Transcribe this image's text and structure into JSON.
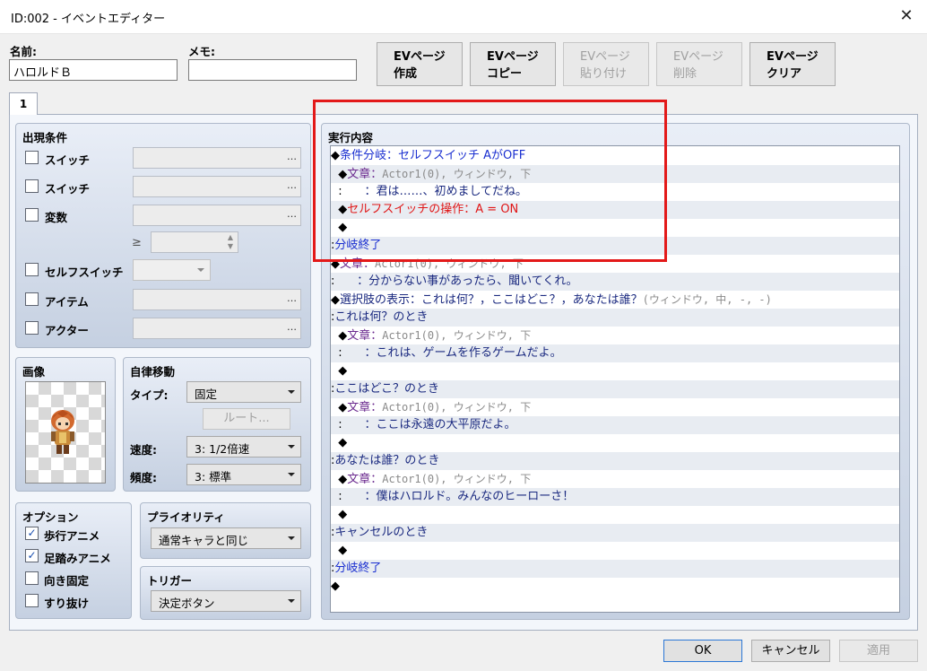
{
  "window": {
    "title": "ID:002 - イベントエディター",
    "close_label": "✕"
  },
  "fields": {
    "name_label": "名前:",
    "name_value": "ハロルドＢ",
    "memo_label": "メモ:",
    "memo_value": ""
  },
  "page_buttons": [
    {
      "line1": "EVページ",
      "line2": "作成",
      "enabled": true
    },
    {
      "line1": "EVページ",
      "line2": "コピー",
      "enabled": true
    },
    {
      "line1": "EVページ",
      "line2": "貼り付け",
      "enabled": false
    },
    {
      "line1": "EVページ",
      "line2": "削除",
      "enabled": false
    },
    {
      "line1": "EVページ",
      "line2": "クリア",
      "enabled": true
    }
  ],
  "tab": {
    "label": "1"
  },
  "conditions": {
    "title": "出現条件",
    "switch1": "スイッチ",
    "switch2": "スイッチ",
    "variable": "変数",
    "ge": "≥",
    "selfswitch": "セルフスイッチ",
    "item": "アイテム",
    "actor": "アクター",
    "dots": "…"
  },
  "image": {
    "title": "画像"
  },
  "autonomous": {
    "title": "自律移動",
    "type_label": "タイプ:",
    "type_value": "固定",
    "route_label": "ルート...",
    "speed_label": "速度:",
    "speed_value": "3: 1/2倍速",
    "freq_label": "頻度:",
    "freq_value": "3: 標準"
  },
  "options": {
    "title": "オプション",
    "walk": "歩行アニメ",
    "step": "足踏みアニメ",
    "dirfix": "向き固定",
    "through": "すり抜け",
    "walk_checked": "✓",
    "step_checked": "✓"
  },
  "priority": {
    "title": "プライオリティ",
    "value": "通常キャラと同じ"
  },
  "trigger": {
    "title": "トリガー",
    "value": "決定ボタン"
  },
  "exec": {
    "title": "実行内容"
  },
  "commands": [
    {
      "p": "◆",
      "a": "条件分岐：セルフスイッチ AがOFF",
      "b": "",
      "ca": "c-blue",
      "cb": ""
    },
    {
      "p": "  ◆",
      "a": "文章：",
      "b": "Actor1(0), ウィンドウ, 下",
      "ca": "c-purple",
      "cb": "c-gray"
    },
    {
      "p": "  :",
      "a": "      ：君は……、初めましてだね。",
      "b": "",
      "ca": "c-navy",
      "cb": ""
    },
    {
      "p": "  ◆",
      "a": "セルフスイッチの操作：A = ON",
      "b": "",
      "ca": "c-red",
      "cb": ""
    },
    {
      "p": "  ◆",
      "a": "",
      "b": "",
      "ca": "",
      "cb": ""
    },
    {
      "p": ":",
      "a": "分岐終了",
      "b": "",
      "ca": "c-blue",
      "cb": ""
    },
    {
      "p": "◆",
      "a": "文章：",
      "b": "Actor1(0), ウィンドウ, 下",
      "ca": "c-purple",
      "cb": "c-gray"
    },
    {
      "p": ":",
      "a": "      ：分からない事があったら、聞いてくれ。",
      "b": "",
      "ca": "c-navy",
      "cb": ""
    },
    {
      "p": "◆",
      "a": "選択肢の表示：これは何？，ここはどこ？，あなたは誰？",
      "b": "(ウィンドウ, 中, -, -)",
      "ca": "c-navy",
      "cb": "c-gray"
    },
    {
      "p": ":",
      "a": "これは何？のとき",
      "b": "",
      "ca": "c-navy",
      "cb": ""
    },
    {
      "p": "  ◆",
      "a": "文章：",
      "b": "Actor1(0), ウィンドウ, 下",
      "ca": "c-purple",
      "cb": "c-gray"
    },
    {
      "p": "  :",
      "a": "      ：これは、ゲームを作るゲームだよ。",
      "b": "",
      "ca": "c-navy",
      "cb": ""
    },
    {
      "p": "  ◆",
      "a": "",
      "b": "",
      "ca": "",
      "cb": ""
    },
    {
      "p": ":",
      "a": "ここはどこ？のとき",
      "b": "",
      "ca": "c-navy",
      "cb": ""
    },
    {
      "p": "  ◆",
      "a": "文章：",
      "b": "Actor1(0), ウィンドウ, 下",
      "ca": "c-purple",
      "cb": "c-gray"
    },
    {
      "p": "  :",
      "a": "      ：ここは永遠の大平原だよ。",
      "b": "",
      "ca": "c-navy",
      "cb": ""
    },
    {
      "p": "  ◆",
      "a": "",
      "b": "",
      "ca": "",
      "cb": ""
    },
    {
      "p": ":",
      "a": "あなたは誰？のとき",
      "b": "",
      "ca": "c-navy",
      "cb": ""
    },
    {
      "p": "  ◆",
      "a": "文章：",
      "b": "Actor1(0), ウィンドウ, 下",
      "ca": "c-purple",
      "cb": "c-gray"
    },
    {
      "p": "  :",
      "a": "      ：僕はハロルド。みんなのヒーローさ！",
      "b": "",
      "ca": "c-navy",
      "cb": ""
    },
    {
      "p": "  ◆",
      "a": "",
      "b": "",
      "ca": "",
      "cb": ""
    },
    {
      "p": ":",
      "a": "キャンセルのとき",
      "b": "",
      "ca": "c-navy",
      "cb": ""
    },
    {
      "p": "  ◆",
      "a": "",
      "b": "",
      "ca": "",
      "cb": ""
    },
    {
      "p": ":",
      "a": "分岐終了",
      "b": "",
      "ca": "c-blue",
      "cb": ""
    },
    {
      "p": "◆",
      "a": "",
      "b": "",
      "ca": "",
      "cb": ""
    }
  ],
  "footer": {
    "ok": "OK",
    "cancel": "キャンセル",
    "apply": "適用"
  }
}
